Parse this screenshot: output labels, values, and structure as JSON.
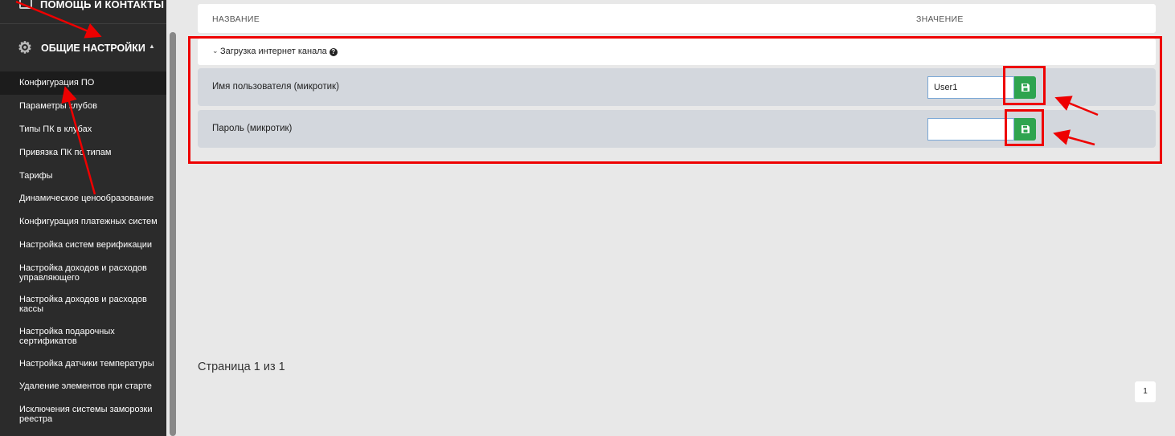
{
  "sidebar": {
    "top_item_label": "Помощь и контакты",
    "section_label": "Общие настройки",
    "items": [
      {
        "label": "Конфигурация ПО"
      },
      {
        "label": "Параметры клубов"
      },
      {
        "label": "Типы ПК в клубах"
      },
      {
        "label": "Привязка ПК по типам"
      },
      {
        "label": "Тарифы"
      },
      {
        "label": "Динамическое ценообразование"
      },
      {
        "label": "Конфигурация платежных систем"
      },
      {
        "label": "Настройка систем верификации"
      },
      {
        "label": "Настройка доходов и расходов управляющего"
      },
      {
        "label": "Настройка доходов и расходов кассы"
      },
      {
        "label": "Настройка подарочных сертификатов"
      },
      {
        "label": "Настройка датчики температуры"
      },
      {
        "label": "Удаление элементов при старте"
      },
      {
        "label": "Исключения системы заморозки реестра"
      }
    ]
  },
  "table": {
    "col_name": "Название",
    "col_value": "Значение",
    "group_title": "Загрузка интернет канала",
    "rows": [
      {
        "name": "Имя пользователя (микротик)",
        "value": "User1"
      },
      {
        "name": "Пароль (микротик)",
        "value": ""
      }
    ]
  },
  "pagination": {
    "summary": "Страница 1 из 1",
    "current_page": "1"
  },
  "colors": {
    "sidebar_bg": "#2b2b2b",
    "save_button": "#2ea44f",
    "annotation_red": "#ee0000"
  }
}
